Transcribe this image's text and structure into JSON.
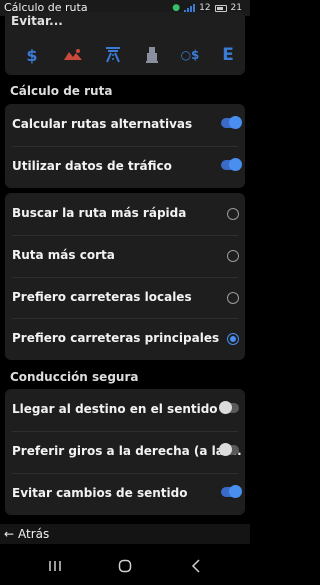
{
  "status_bar": {
    "title": "Cálculo de ruta",
    "time": "21",
    "indicator": "12"
  },
  "avoid": {
    "title": "Evitar...",
    "icons": [
      "dollar-icon",
      "unpaved-road-icon",
      "highway-icon",
      "ferry-icon",
      "toll-sticker-icon",
      "border-icon"
    ]
  },
  "sections": {
    "calc": "Cálculo de ruta",
    "safe": "Conducción segura"
  },
  "toggles_top": [
    {
      "label": "Calcular rutas alternativas",
      "on": true
    },
    {
      "label": "Utilizar datos de tráfico",
      "on": true
    }
  ],
  "radios": [
    {
      "label": "Buscar la ruta más rápida",
      "checked": false
    },
    {
      "label": "Ruta más corta",
      "checked": false
    },
    {
      "label": "Prefiero carreteras locales",
      "checked": false
    },
    {
      "label": "Prefiero carreteras principales",
      "checked": true
    }
  ],
  "toggles_safe": [
    {
      "label": "Llegar al destino en el sentido ...",
      "on": false
    },
    {
      "label": "Preferir giros a la derecha (a la ...",
      "on": false
    },
    {
      "label": "Evitar cambios de sentido",
      "on": true
    }
  ],
  "back": {
    "label": "Atrás"
  },
  "colors": {
    "accent": "#4a8ef0",
    "card": "#1e1e1e",
    "background": "#000000"
  }
}
